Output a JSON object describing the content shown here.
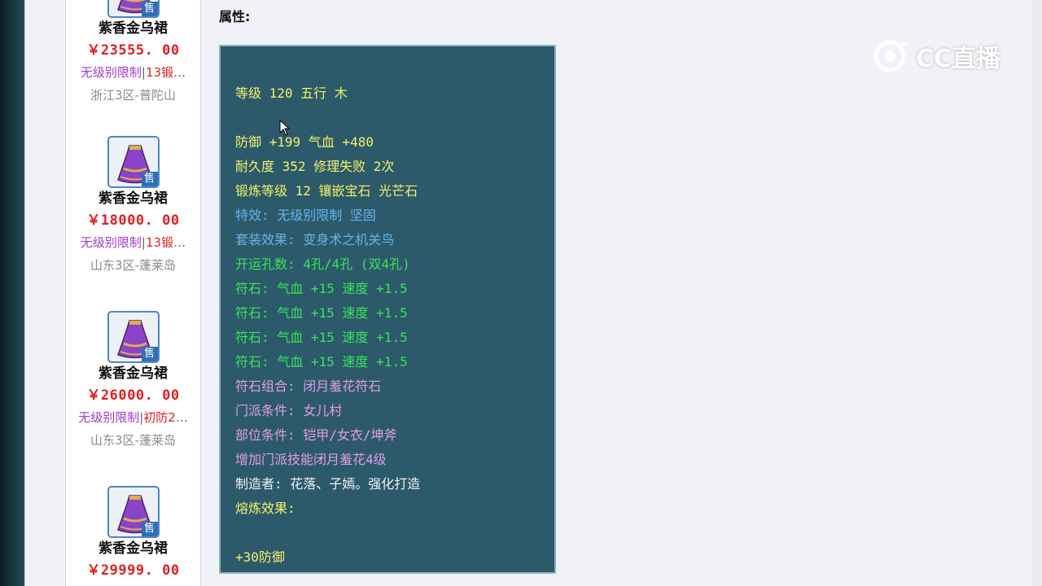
{
  "sidebar": {
    "items": [
      {
        "name": "紫香金乌裙",
        "price": "￥23555. 00",
        "tag1": "无级别限制",
        "sep": "|",
        "tag2": "13锻",
        "more": "…",
        "server": "浙江3区-普陀山",
        "badge": "售"
      },
      {
        "name": "紫香金乌裙",
        "price": "￥18000. 00",
        "tag1": "无级别限制",
        "sep": "|",
        "tag2": "13锻",
        "more": "…",
        "server": "山东3区-蓬莱岛",
        "badge": "售"
      },
      {
        "name": "紫香金乌裙",
        "price": "￥26000. 00",
        "tag1": "无级别限制",
        "sep": "|",
        "tag2": "初防2",
        "more": "…",
        "server": "山东3区-蓬莱岛",
        "badge": "售"
      },
      {
        "name": "紫香金乌裙",
        "price": "￥29999. 00",
        "badge": "售"
      }
    ]
  },
  "attributes": {
    "label": "属性:",
    "lines": [
      "等级 120 五行 木",
      "防御 +199 气血 +480",
      "耐久度 352 修理失败 2次",
      "锻炼等级 12 镶嵌宝石 光芒石",
      "特效: 无级别限制 坚固",
      "套装效果: 变身术之机关鸟",
      "开运孔数: 4孔/4孔 (双4孔)",
      "符石: 气血 +15 速度 +1.5",
      "符石: 气血 +15 速度 +1.5",
      "符石: 气血 +15 速度 +1.5",
      "符石: 气血 +15 速度 +1.5",
      "符石组合: 闭月羞花符石",
      "门派条件: 女儿村",
      "部位条件: 铠甲/女衣/坤斧",
      "增加门派技能闭月羞花4级",
      "制造者: 花落、子嫣。强化打造",
      "熔炼效果:",
      "+30防御"
    ]
  },
  "watermark": {
    "text": "CC直播"
  },
  "colors": {
    "panel_bg": "#2c5a6a",
    "yellow": "#f3f06a",
    "blue": "#64b4ec",
    "green": "#39e35c",
    "pink": "#e59ce6",
    "price_red": "#e02020",
    "tag_purple": "#a43ad0"
  },
  "icons": [
    "skirt-icon",
    "sale-badge",
    "mouse-cursor-icon",
    "cc-logo-icon"
  ]
}
